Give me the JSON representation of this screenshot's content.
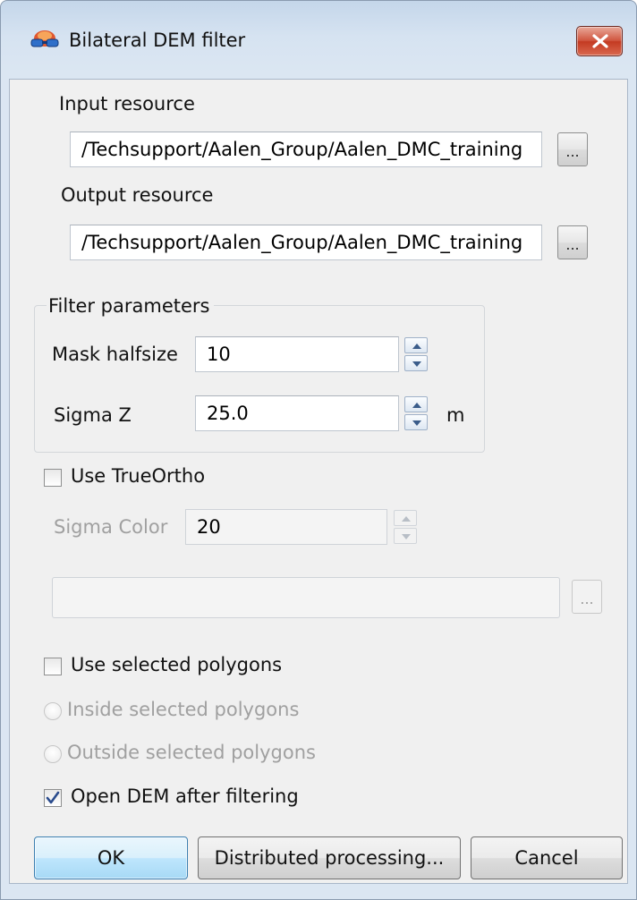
{
  "window": {
    "title": "Bilateral DEM filter"
  },
  "input_resource": {
    "label": "Input resource",
    "value": "/Techsupport/Aalen_Group/Aalen_DMC_training",
    "browse_label": "..."
  },
  "output_resource": {
    "label": "Output resource",
    "value": "/Techsupport/Aalen_Group/Aalen_DMC_training",
    "browse_label": "..."
  },
  "filter_parameters": {
    "title": "Filter parameters",
    "mask_halfsize": {
      "label": "Mask halfsize",
      "value": "10"
    },
    "sigma_z": {
      "label": "Sigma Z",
      "value": "25.0",
      "unit": "m"
    }
  },
  "true_ortho": {
    "label": "Use TrueOrtho",
    "checked": false,
    "sigma_color": {
      "label": "Sigma Color",
      "value": "20"
    },
    "path_value": "",
    "browse_label": "..."
  },
  "polygons": {
    "use_selected_label": "Use selected polygons",
    "use_selected_checked": false,
    "inside_label": "Inside selected polygons",
    "outside_label": "Outside selected polygons"
  },
  "open_dem": {
    "label": "Open DEM after filtering",
    "checked": true
  },
  "buttons": {
    "ok": "OK",
    "distributed": "Distributed processing...",
    "cancel": "Cancel"
  },
  "colors": {
    "accent": "#3c7fb1",
    "close": "#c43a22",
    "disabled_text": "#a0a0a0",
    "check": "#2a4b8d"
  }
}
